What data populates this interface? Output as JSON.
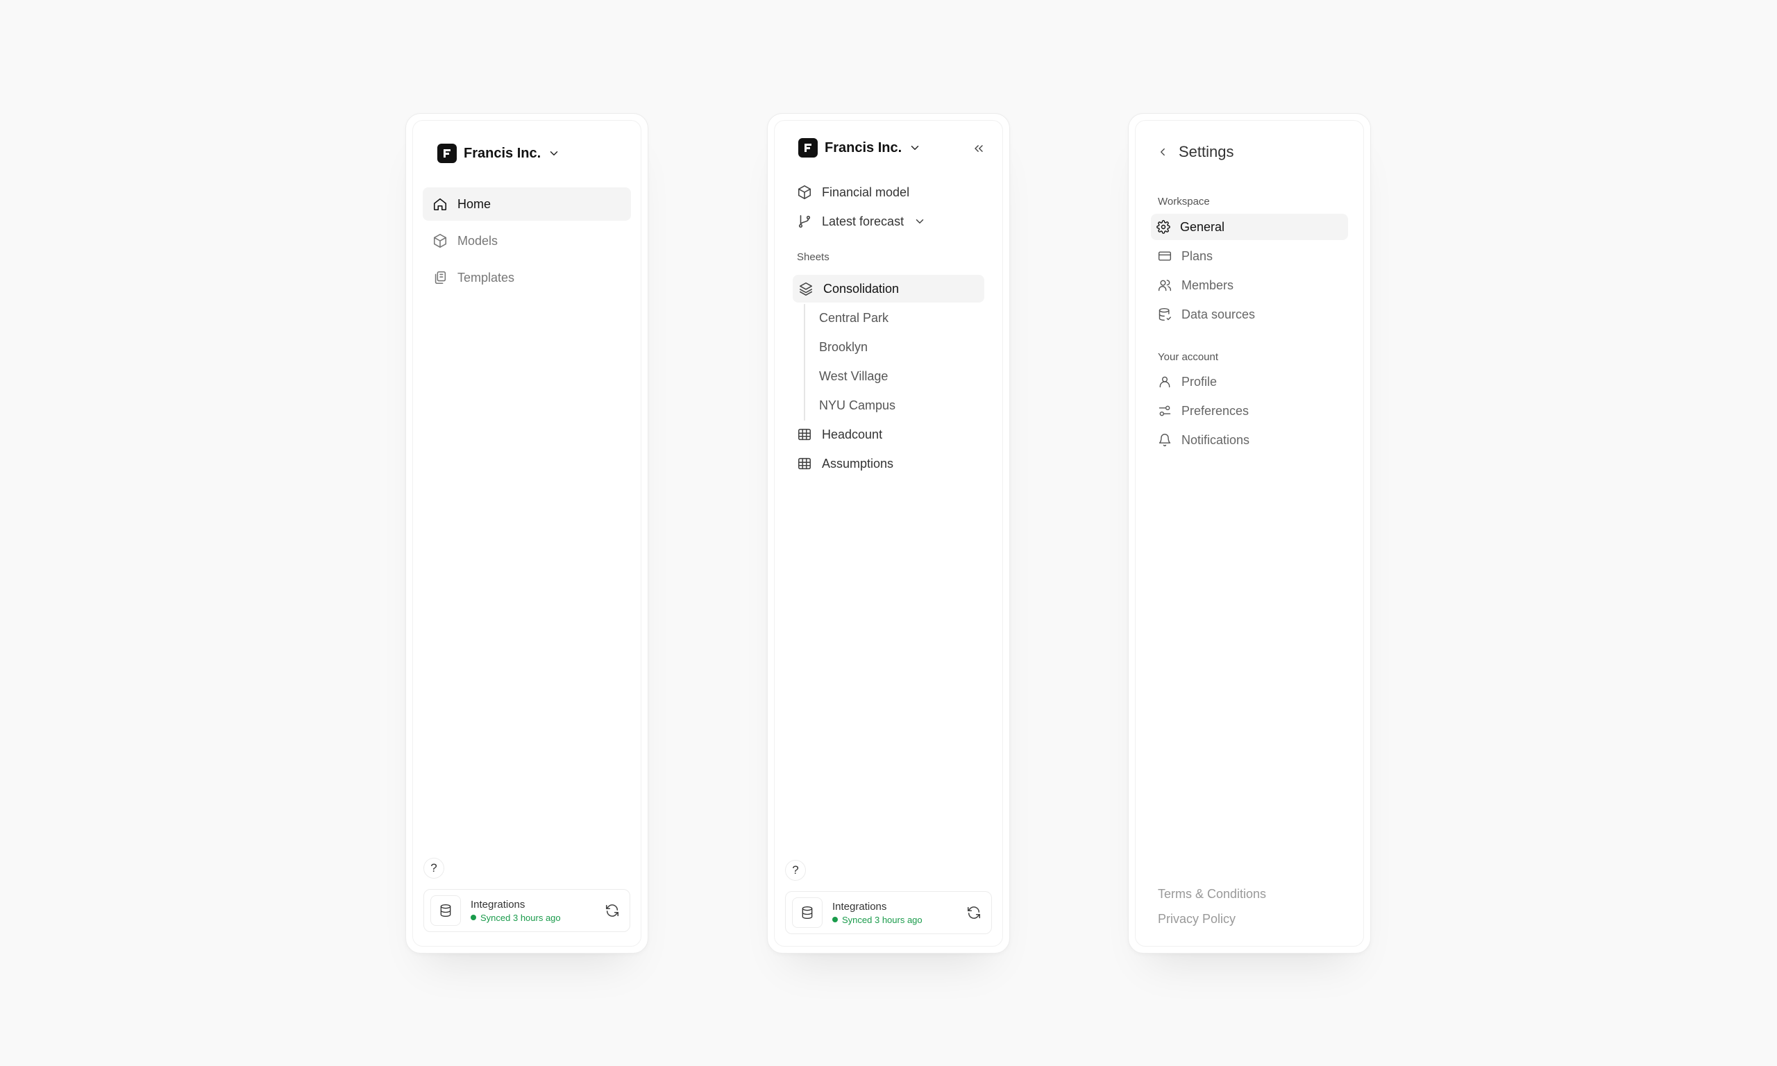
{
  "panel1": {
    "workspace": "Francis Inc.",
    "nav": [
      {
        "label": "Home",
        "icon": "home-icon",
        "active": true
      },
      {
        "label": "Models",
        "icon": "cube-icon",
        "active": false
      },
      {
        "label": "Templates",
        "icon": "templates-icon",
        "active": false
      }
    ],
    "help": "?",
    "integrations": {
      "title": "Integrations",
      "status": "Synced 3 hours ago"
    }
  },
  "panel2": {
    "workspace": "Francis Inc.",
    "model": "Financial model",
    "forecast": "Latest forecast",
    "sheets_label": "Sheets",
    "sheets": [
      {
        "label": "Consolidation",
        "icon": "layers-icon",
        "active": true
      },
      {
        "label": "Central Park",
        "child": true
      },
      {
        "label": "Brooklyn",
        "child": true
      },
      {
        "label": "West Village",
        "child": true
      },
      {
        "label": "NYU Campus",
        "child": true
      },
      {
        "label": "Headcount",
        "icon": "table-icon"
      },
      {
        "label": "Assumptions",
        "icon": "table-icon"
      }
    ],
    "help": "?",
    "integrations": {
      "title": "Integrations",
      "status": "Synced 3 hours ago"
    }
  },
  "panel3": {
    "title": "Settings",
    "workspace_label": "Workspace",
    "workspace_items": [
      {
        "label": "General",
        "icon": "gear-icon",
        "active": true
      },
      {
        "label": "Plans",
        "icon": "credit-card-icon"
      },
      {
        "label": "Members",
        "icon": "users-icon"
      },
      {
        "label": "Data sources",
        "icon": "database-icon"
      }
    ],
    "account_label": "Your account",
    "account_items": [
      {
        "label": "Profile",
        "icon": "user-icon"
      },
      {
        "label": "Preferences",
        "icon": "sliders-icon"
      },
      {
        "label": "Notifications",
        "icon": "bell-icon"
      }
    ],
    "footer": {
      "terms": "Terms & Conditions",
      "privacy": "Privacy Policy"
    }
  },
  "colors": {
    "accent_green": "#1a9b4b",
    "active_bg": "#f4f4f4"
  }
}
